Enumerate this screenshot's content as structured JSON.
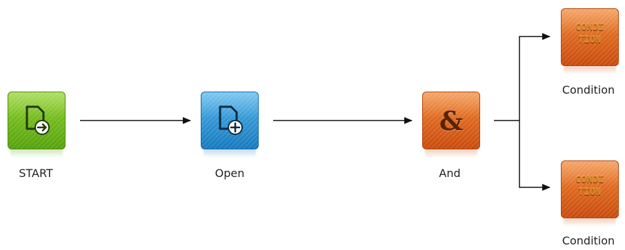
{
  "nodes": {
    "start": {
      "label": "START",
      "icon": "document-arrow-icon",
      "color": "#6cb51a"
    },
    "open": {
      "label": "Open",
      "icon": "document-add-icon",
      "color": "#2391d3"
    },
    "and": {
      "label": "And",
      "symbol": "&",
      "color": "#e0661d"
    },
    "condition_top": {
      "label": "Condition",
      "tile_text_1": "CONDI",
      "tile_text_2": "TION",
      "color": "#e0661d"
    },
    "condition_bottom": {
      "label": "Condition",
      "tile_text_1": "CONDI",
      "tile_text_2": "TION",
      "color": "#e0661d"
    }
  },
  "edges": [
    {
      "from": "start",
      "to": "open"
    },
    {
      "from": "open",
      "to": "and"
    },
    {
      "from": "and",
      "to": "condition_top"
    },
    {
      "from": "and",
      "to": "condition_bottom"
    }
  ]
}
